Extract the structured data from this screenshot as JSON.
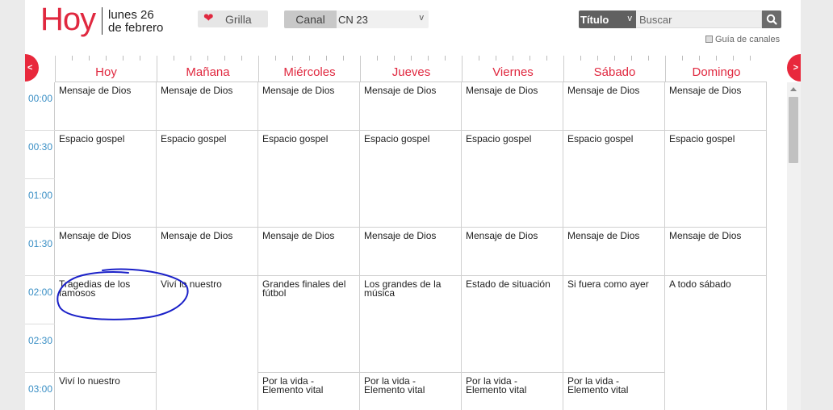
{
  "header": {
    "today": "Hoy",
    "date_line1": "lunes 26",
    "date_line2": "de febrero",
    "grilla_label": "Grilla",
    "canal_label": "Canal",
    "canal_value": "CN 23",
    "search_mode": "Título",
    "search_placeholder": "Buscar",
    "guia_label": "Guía de canales"
  },
  "nav": {
    "prev": "<",
    "next": ">"
  },
  "days": [
    "Hoy",
    "Mañana",
    "Miércoles",
    "Jueves",
    "Viernes",
    "Sábado",
    "Domingo"
  ],
  "times": [
    "00:00",
    "00:30",
    "01:00",
    "01:30",
    "02:00",
    "02:30",
    "03:00"
  ],
  "programs": {
    "mensaje": "Mensaje de Dios",
    "gospel": "Espacio gospel",
    "tragedias": "Tragedias de los famosos",
    "vivi": "Viví lo nuestro",
    "grandes_finales": "Grandes finales del fútbol",
    "grandes_musica": "Los grandes de la música",
    "estado": "Estado de situación",
    "si_fuera": "Si fuera como ayer",
    "todo_sabado": "A todo sábado",
    "por_la_vida": "Por la vida - Elemento vital"
  },
  "colors": {
    "accent": "#e0283f",
    "time_text": "#3a8fc5",
    "annotation": "#1a20c8"
  }
}
